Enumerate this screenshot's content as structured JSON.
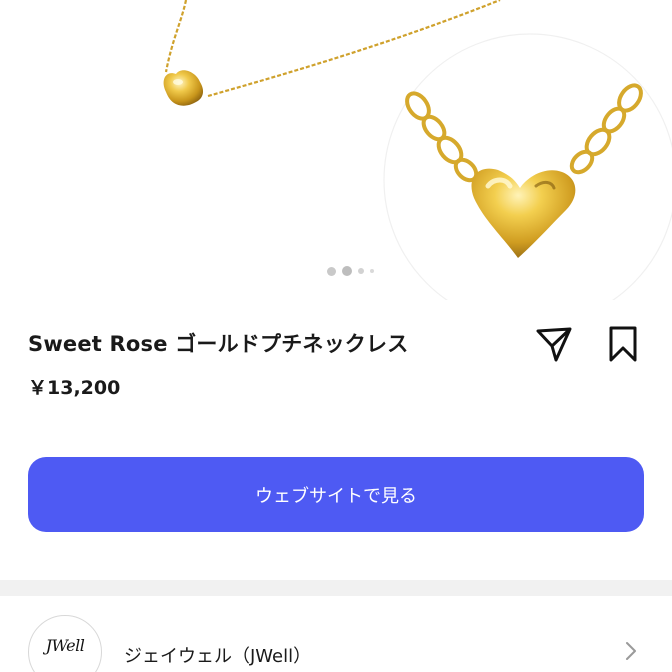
{
  "product": {
    "title": "Sweet Rose ゴールドプチネックレス",
    "price": "￥13,200"
  },
  "carousel": {
    "slide_count": 4,
    "active_index": 1
  },
  "actions": {
    "share_icon": "send-icon",
    "bookmark_icon": "bookmark-icon"
  },
  "cta": {
    "label": "ウェブサイトで見る",
    "color": "#4e5af3"
  },
  "seller": {
    "name": "ジェイウェル（JWell）",
    "logo_text": "JWell"
  },
  "colors": {
    "gold": "#d9ad2b",
    "accent": "#4e5af3",
    "divider": "#f1f1f1"
  }
}
